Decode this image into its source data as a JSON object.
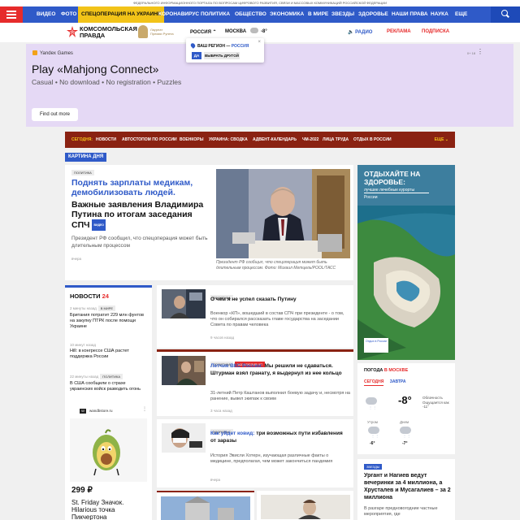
{
  "topstrip": "ФЕДЕРАЛЬНОГО ИНФОРМАЦИОННОГО ПОРТАЛА ПО ВОПРОСАМ ЦИФРОВОГО РАЗВИТИЯ, СВЯЗИ И МАССОВЫХ КОММУНИКАЦИЙ РОССИЙСКОЙ ФЕДЕРАЦИИ",
  "nav": {
    "items": [
      "ВИДЕО",
      "ФОТО",
      "СПЕЦОПЕРАЦИЯ НА УКРАИНЕ",
      "КОРОНАВИРУС",
      "ПОЛИТИКА",
      "ОБЩЕСТВО",
      "ЭКОНОМИКА",
      "В МИРЕ",
      "ЗВЕЗДЫ",
      "ЗДОРОВЬЕ",
      "НАШИ ПРАВА",
      "НАУКА",
      "ЕЩЕ"
    ]
  },
  "header": {
    "logo_line1": "КОМСОМОЛЬСКАЯ",
    "logo_line2": "ПРАВДА",
    "award_line1": "Лауреат",
    "award_line2": "Премии Рунета",
    "city_selector": "РОССИЯ",
    "city_current": "МОСКВА",
    "temperature": "-8°",
    "radio": "РАДИО",
    "reklama": "РЕКЛАМА",
    "podpiska": "ПОДПИСКА"
  },
  "region_popup": {
    "question": "ВАШ РЕГИОН —",
    "region": "РОССИЯ",
    "yes": "ДА",
    "other": "ВЫБРАТЬ ДРУГОЙ",
    "close": "×"
  },
  "ad": {
    "brand": "Yandex Games",
    "title": "Play «Mahjong Connect»",
    "subtitle": "Casual • No download • No registration • Puzzles",
    "button": "Find out more",
    "age": "0+ 18"
  },
  "secnav": {
    "today": "СЕГОДНЯ:",
    "items": [
      "НОВОСТИ",
      "АВТОСТОПОМ ПО РОССИИ",
      "ВОЕНКОРЫ",
      "УКРАИНА: СВОДКА",
      "АДВЕНТ-КАЛЕНДАРЬ",
      "ЧМ-2022",
      "ЛИЦА ТРУДА",
      "ОТДЫХ В РОССИИ"
    ],
    "more": "ЕЩЕ"
  },
  "kartina": "КАРТИНА ДНЯ",
  "feature": {
    "tag": "ПОЛИТИКА",
    "title_blue": "Поднять зарплаты медикам, демобилизовать людей.",
    "title_black": "Важные заявления Владимира Путина по итогам заседания СПЧ",
    "video": "ВИДЕО",
    "lead": "Президент РФ сообщил, что спецоперация может быть длительным процессом",
    "time": "вчера",
    "caption": "Президент РФ сообщил, что спецоперация может быть длительным процессом. Фото: Михаил Метцель/POOL/ТАСС"
  },
  "adv_right": {
    "title": "ОТДЫХАЙТЕ НА ЗДОРОВЬЕ:",
    "sub1": "лучшие лечебные курорты",
    "sub2": "России",
    "badge": "Отдых в России"
  },
  "news": {
    "header": "НОВОСТИ",
    "count": "24",
    "items": [
      {
        "time": "2 минуты назад",
        "tag": "В МИРЕ",
        "text": "Британия потратит 229 млн фунтов на закупку ПТРК после помощи Украине"
      },
      {
        "time": "10 минут назад",
        "tag": "В МИРЕ",
        "text": "Hill: в конгрессе США растет поддержка России"
      },
      {
        "time": "22 минуты назад",
        "tag": "ПОЛИТИКА",
        "text": "В США сообщили о страхе украинских войск разводить огонь"
      }
    ],
    "product": {
      "shop_logo": "W",
      "site": "wandbstore.ru",
      "price": "299 ₽",
      "name": "St. Friday Значок. Hilarious точка Пикчертона"
    }
  },
  "cards": [
    {
      "tags": [
        "ПОЛИТИКА"
      ],
      "title_blue": "",
      "title": "О чем я не успел сказать Путину",
      "lead": "Военкор «КП», вошедший в состав СПЧ при президенте - о том, что он собирался рассказать главе государства на заседании Совета по правам человека",
      "time": "9 часов назад"
    },
    {
      "tags": [
        "ПОЛИТИКА",
        "ЭКСКЛЮЗИВ КП"
      ],
      "title_blue": "Летчик ВКС России:",
      "title": "Мы решили не сдаваться. Штурман взял гранату, я выдернул из нее кольцо",
      "lead": "31-летний Петр Каштанов выполнил боевую задачу и, несмотря на ранение, вывел экипаж к своим",
      "time": "3 часа назад"
    },
    {
      "tags": [
        "ЗДОРОВЬЕ"
      ],
      "title_blue": "Как уйдет ковид:",
      "title": "три возможных пути избавления от заразы",
      "lead": "История Эвисли Хотерн, изучающая различные факты о медицине, предполагая, чем может закончиться пандемия",
      "time": "вчера"
    }
  ],
  "weather": {
    "header": "ПОГОДА",
    "city": "В МОСКВЕ",
    "tab_today": "СЕГОДНЯ",
    "tab_tomorrow": "ЗАВТРА",
    "now": "-8°",
    "desc": "Облачность Ощущается как -11°",
    "morning_label": "Утром",
    "morning": "-6°",
    "day_label": "Днем",
    "day": "-7°"
  },
  "promo": {
    "tag": "ЗВЕЗДЫ",
    "title": "Ургант и Нагиев ведут вечеринки за 4 миллиона, а Хрусталев и Мусагалиев – за 2 миллиона",
    "lead": "В разгаре предновогодние частные мероприятия, где"
  },
  "colors": {
    "brand_blue": "#2f5ac8",
    "brand_red": "#e62b2b",
    "accent_yellow": "#f2c318",
    "section_brown": "#8a2212",
    "ad_lilac": "#e5d9f5"
  }
}
